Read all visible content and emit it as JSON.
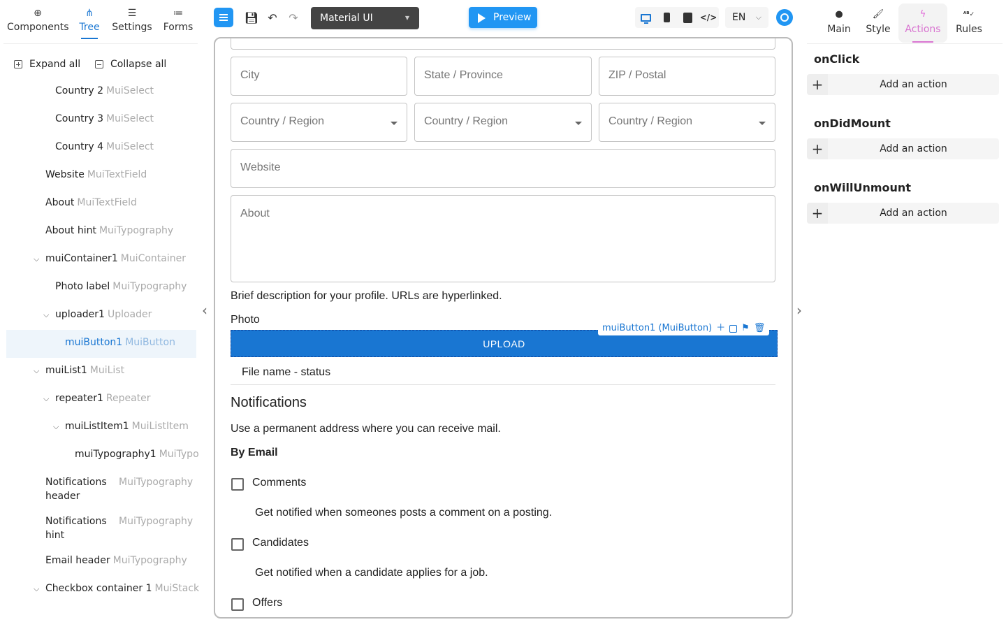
{
  "left_panel": {
    "tabs": [
      {
        "label": "Components",
        "icon": "add-circle-icon"
      },
      {
        "label": "Tree",
        "icon": "tree-icon"
      },
      {
        "label": "Settings",
        "icon": "sliders-icon"
      },
      {
        "label": "Forms",
        "icon": "list-icon"
      }
    ],
    "expand_all": "Expand all",
    "collapse_all": "Collapse all",
    "tree": [
      {
        "name": "Country 2",
        "type": "MuiSelect"
      },
      {
        "name": "Country 3",
        "type": "MuiSelect"
      },
      {
        "name": "Country 4",
        "type": "MuiSelect"
      },
      {
        "name": "Website",
        "type": "MuiTextField"
      },
      {
        "name": "About",
        "type": "MuiTextField"
      },
      {
        "name": "About hint",
        "type": "MuiTypography"
      },
      {
        "name": "muiContainer1",
        "type": "MuiContainer"
      },
      {
        "name": "Photo label",
        "type": "MuiTypography"
      },
      {
        "name": "uploader1",
        "type": "Uploader"
      },
      {
        "name": "muiButton1",
        "type": "MuiButton"
      },
      {
        "name": "muiList1",
        "type": "MuiList"
      },
      {
        "name": "repeater1",
        "type": "Repeater"
      },
      {
        "name": "muiListItem1",
        "type": "MuiListItem"
      },
      {
        "name": "muiTypography1",
        "type": "MuiTypo"
      },
      {
        "name": "Notifications header",
        "name_line1": "Notifications",
        "name_line2": "header",
        "type": "MuiTypography"
      },
      {
        "name": "Notifications hint",
        "name_line1": "Notifications",
        "name_line2": "hint",
        "type": "MuiTypography"
      },
      {
        "name": "Email header",
        "type": "MuiTypography"
      },
      {
        "name": "Checkbox container 1",
        "type": "MuiStack"
      }
    ]
  },
  "toolbar": {
    "theme_select": "Material UI",
    "preview": "Preview",
    "language": "EN",
    "accent": "#2196f3"
  },
  "form": {
    "city": "City",
    "state": "State / Province",
    "zip": "ZIP / Postal",
    "country_1": "Country / Region",
    "country_2": "Country / Region",
    "country_3": "Country / Region",
    "website": "Website",
    "about": "About",
    "about_hint": "Brief description for your profile. URLs are hyperlinked.",
    "photo_label": "Photo",
    "upload": "UPLOAD",
    "selected_label": "muiButton1 (MuiButton)",
    "file_status": "File name - status",
    "notifications_header": "Notifications",
    "notifications_hint": "Use a permanent address where you can receive mail.",
    "email_header": "By Email",
    "checkboxes": [
      {
        "label": "Comments",
        "hint": "Get notified when someones posts a comment on a posting.",
        "checked": false
      },
      {
        "label": "Candidates",
        "hint": "Get notified when a candidate applies for a job.",
        "checked": false
      },
      {
        "label": "Offers",
        "checked": false
      }
    ]
  },
  "right_panel": {
    "tabs": [
      {
        "label": "Main",
        "icon": "circle-icon"
      },
      {
        "label": "Style",
        "icon": "brush-icon"
      },
      {
        "label": "Actions",
        "icon": "bolt-icon"
      },
      {
        "label": "Rules",
        "icon": "spellcheck-icon"
      }
    ],
    "events": [
      {
        "title": "onClick",
        "add": "Add an action"
      },
      {
        "title": "onDidMount",
        "add": "Add an action"
      },
      {
        "title": "onWillUnmount",
        "add": "Add an action"
      }
    ],
    "active_color": "#d873d0"
  }
}
